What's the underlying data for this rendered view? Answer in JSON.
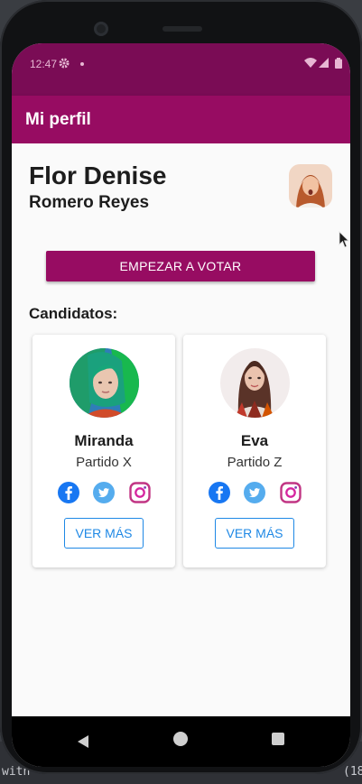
{
  "status_bar": {
    "time": "12:47"
  },
  "app_bar": {
    "title": "Mi perfil"
  },
  "profile": {
    "first_names": "Flor Denise",
    "last_names": "Romero Reyes"
  },
  "actions": {
    "vote_label": "EMPEZAR A VOTAR"
  },
  "candidates_section": {
    "title": "Candidatos:"
  },
  "candidates": [
    {
      "name": "Miranda",
      "party": "Partido X",
      "more_label": "VER MÁS"
    },
    {
      "name": "Eva",
      "party": "Partido Z",
      "more_label": "VER MÁS"
    }
  ],
  "colors": {
    "primary": "#970c62",
    "status_bar": "#7a0c55",
    "link": "#1e88e5"
  },
  "icons": [
    "settings-icon",
    "wifi-icon",
    "battery-icon",
    "facebook-icon",
    "twitter-icon",
    "instagram-icon",
    "back-icon",
    "home-icon",
    "recents-icon"
  ],
  "background_text": {
    "left": "with",
    "right": "(18,"
  }
}
